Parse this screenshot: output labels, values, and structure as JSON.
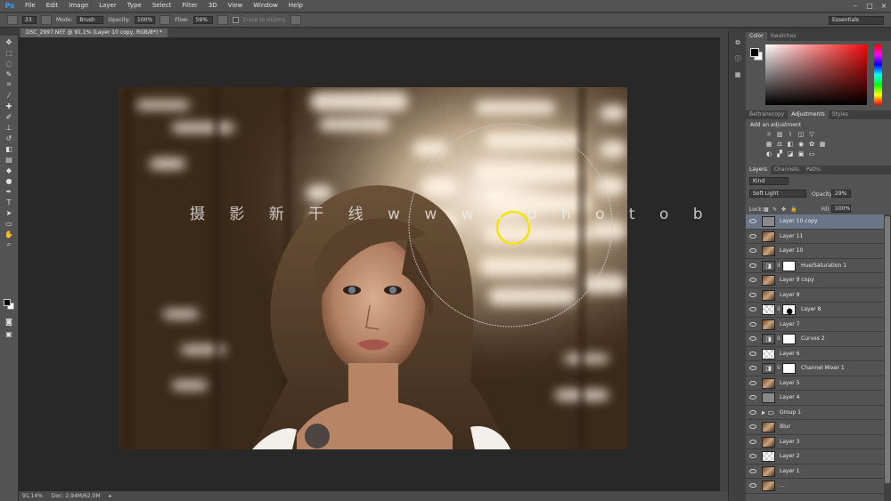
{
  "app": {
    "logo": "Ps"
  },
  "menu": [
    "File",
    "Edit",
    "Image",
    "Layer",
    "Type",
    "Select",
    "Filter",
    "3D",
    "View",
    "Window",
    "Help"
  ],
  "window_controls": [
    "–",
    "□",
    "×"
  ],
  "options_bar": {
    "brush_size": "33",
    "mode_label": "Mode:",
    "mode_value": "Brush",
    "opacity_label": "Opacity:",
    "opacity_value": "100%",
    "flow_label": "Flow:",
    "flow_value": "59%",
    "erase_history": "Erase to History",
    "workspace": "Essentials"
  },
  "document": {
    "tab_title": "DSC_2997.NEF @ 91,1% (Layer 10 copy, RGB/8*) *",
    "watermark": "摄 影 新 干 线   w w w . p h o t o b o s . v i p"
  },
  "status_bar": {
    "zoom": "91,14%",
    "doc": "Doc: 2,94M/62,0M"
  },
  "colors": {
    "brush_circle": "#f2e40a",
    "selected_layer": "#6b7588",
    "panel_bg": "#535353"
  },
  "color_panel": {
    "tabs": [
      "Color",
      "Swatches"
    ]
  },
  "adjustments_panel": {
    "tabs": [
      "Beltranscopy",
      "Adjustments",
      "Styles"
    ],
    "title": "Add an adjustment"
  },
  "layers_panel": {
    "tabs": [
      "Layers",
      "Channels",
      "Paths"
    ],
    "filter_kind": "Kind",
    "blend_mode": "Soft Light",
    "opacity_label": "Opacity:",
    "opacity_value": "29%",
    "lock_label": "Lock:",
    "fill_label": "Fill:",
    "fill_value": "100%",
    "layers": [
      {
        "name": "Layer 10 copy",
        "thumb": "gray",
        "selected": true
      },
      {
        "name": "Layer 11",
        "thumb": "photo"
      },
      {
        "name": "Layer 10",
        "thumb": "photo"
      },
      {
        "name": "Hue/Saturation 1",
        "thumb": "adj",
        "mask": "white"
      },
      {
        "name": "Layer 9 copy",
        "thumb": "photo"
      },
      {
        "name": "Layer 9",
        "thumb": "photo"
      },
      {
        "name": "Layer 8",
        "thumb": "trans",
        "mask": "silhouette"
      },
      {
        "name": "Layer 7",
        "thumb": "photo"
      },
      {
        "name": "Curves 2",
        "thumb": "adj",
        "mask": "white"
      },
      {
        "name": "Layer 6",
        "thumb": "trans"
      },
      {
        "name": "Channel Mixer 1",
        "thumb": "adj",
        "mask": "white"
      },
      {
        "name": "Layer 5",
        "thumb": "photo"
      },
      {
        "name": "Layer 4",
        "thumb": "gray"
      },
      {
        "name": "Group 1",
        "thumb": "folder"
      },
      {
        "name": "Blur",
        "thumb": "photo"
      },
      {
        "name": "Layer 3",
        "thumb": "photo"
      },
      {
        "name": "Layer 2",
        "thumb": "trans"
      },
      {
        "name": "Layer 1",
        "thumb": "photo"
      },
      {
        "name": "...",
        "thumb": "photo"
      }
    ]
  }
}
